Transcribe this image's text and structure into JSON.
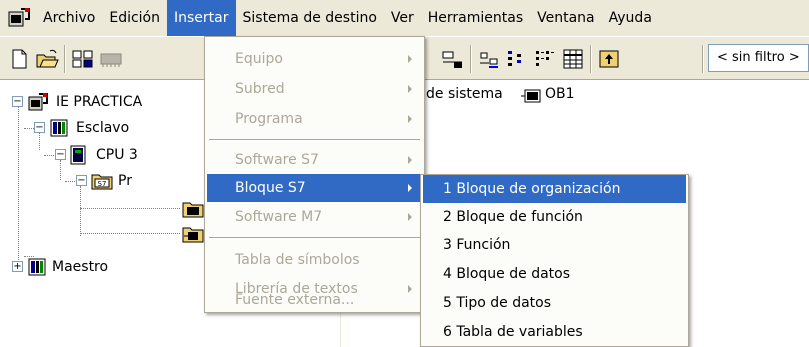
{
  "menubar": {
    "items": [
      "Archivo",
      "Edición",
      "Insertar",
      "Sistema de destino",
      "Ver",
      "Herramientas",
      "Ventana",
      "Ayuda"
    ],
    "active": "Insertar"
  },
  "toolbar": {
    "filter_value": "< sin filtro >"
  },
  "tree": {
    "root": "IE PRACTICA",
    "slave": "Esclavo",
    "cpu": "CPU 3",
    "program": "Pr",
    "master": "Maestro"
  },
  "content": {
    "system_data_label": "de sistema",
    "ob1_label": "OB1"
  },
  "insert_menu": {
    "items": [
      {
        "label": "Equipo",
        "enabled": false,
        "submenu": true
      },
      {
        "label": "Subred",
        "enabled": false,
        "submenu": true
      },
      {
        "label": "Programa",
        "enabled": false,
        "submenu": true
      },
      {
        "label": "Software S7",
        "enabled": false,
        "submenu": true
      },
      {
        "label": "Bloque S7",
        "enabled": true,
        "submenu": true,
        "highlighted": true
      },
      {
        "label": "Software M7",
        "enabled": false,
        "submenu": true
      },
      {
        "label": "Tabla de símbolos",
        "enabled": false,
        "submenu": false
      },
      {
        "label": "Librería de textos",
        "enabled": false,
        "submenu": true
      },
      {
        "label": "Fuente externa...",
        "enabled": false,
        "submenu": false
      }
    ]
  },
  "block_submenu": {
    "items": [
      "1 Bloque de organización",
      "2 Bloque de función",
      "3 Función",
      "4 Bloque de datos",
      "5 Tipo de datos",
      "6 Tabla de variables"
    ]
  },
  "colors": {
    "highlight": "#316ac5",
    "chrome": "#ece9d8",
    "disabled_text": "#aca899"
  }
}
